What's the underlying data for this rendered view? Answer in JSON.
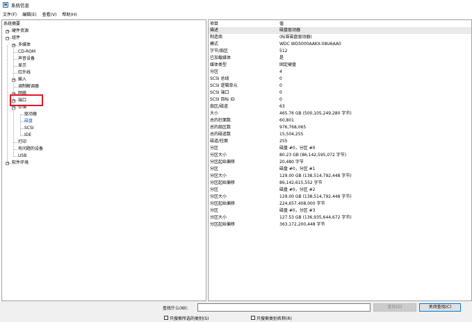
{
  "window": {
    "title": "系统信息",
    "icon": "system-info-icon"
  },
  "menu": [
    {
      "label": "文件(F)"
    },
    {
      "label": "编辑(E)"
    },
    {
      "label": "查看(V)"
    },
    {
      "label": "帮助(H)"
    }
  ],
  "tree": [
    {
      "label": "系统摘要",
      "level": 0,
      "expander": ""
    },
    {
      "label": "硬件资源",
      "level": 1,
      "expander": "+"
    },
    {
      "label": "组件",
      "level": 1,
      "expander": "−"
    },
    {
      "label": "多媒体",
      "level": 2,
      "expander": "+"
    },
    {
      "label": "CD-ROM",
      "level": 2,
      "expander": ""
    },
    {
      "label": "声音设备",
      "level": 2,
      "expander": ""
    },
    {
      "label": "显示",
      "level": 2,
      "expander": ""
    },
    {
      "label": "红外线",
      "level": 2,
      "expander": ""
    },
    {
      "label": "输入",
      "level": 2,
      "expander": "+"
    },
    {
      "label": "调制解调器",
      "level": 2,
      "expander": ""
    },
    {
      "label": "网络",
      "level": 2,
      "expander": "+"
    },
    {
      "label": "端口",
      "level": 2,
      "expander": "+"
    },
    {
      "label": "存储",
      "level": 2,
      "expander": "−"
    },
    {
      "label": "驱动器",
      "level": 3,
      "expander": ""
    },
    {
      "label": "磁盘",
      "level": 3,
      "expander": "",
      "selected": true
    },
    {
      "label": "SCSI",
      "level": 3,
      "expander": ""
    },
    {
      "label": "IDE",
      "level": 3,
      "expander": ""
    },
    {
      "label": "打印",
      "level": 2,
      "expander": ""
    },
    {
      "label": "有问题的设备",
      "level": 2,
      "expander": ""
    },
    {
      "label": "USB",
      "level": 2,
      "expander": ""
    },
    {
      "label": "软件环境",
      "level": 1,
      "expander": "+"
    }
  ],
  "details": {
    "header": {
      "key": "项目",
      "value": "值"
    },
    "rows": [
      {
        "key": "描述",
        "value": "磁盘驱动器"
      },
      {
        "key": "制造商",
        "value": "(标准磁盘驱动器)"
      },
      {
        "key": "模式",
        "value": "WDC WD5000AAKX-08U6AA0"
      },
      {
        "key": "字节/扇区",
        "value": "512"
      },
      {
        "key": "已加载媒体",
        "value": "是"
      },
      {
        "key": "媒体类型",
        "value": "固定硬盘"
      },
      {
        "key": "分区",
        "value": "4"
      },
      {
        "key": "SCSI 总线",
        "value": "0"
      },
      {
        "key": "SCSI 逻辑单元",
        "value": "0"
      },
      {
        "key": "SCSI 端口",
        "value": "0"
      },
      {
        "key": "SCSI 目标 ID",
        "value": "0"
      },
      {
        "key": "扇区/磁道",
        "value": "63"
      },
      {
        "key": "大小",
        "value": "465.76 GB (500,105,249,280 字节)"
      },
      {
        "key": "总的柱面数",
        "value": "60,801"
      },
      {
        "key": "总的扇区数",
        "value": "976,768,065"
      },
      {
        "key": "总的磁道数",
        "value": "15,504,255"
      },
      {
        "key": "磁道/柱面",
        "value": "255"
      },
      {
        "key": "分区",
        "value": "磁盘 #0，分区 #0"
      },
      {
        "key": "分区大小",
        "value": "80.23 GB (86,142,595,072 字节)"
      },
      {
        "key": "分区起始偏移",
        "value": "20,480 字节"
      },
      {
        "key": "分区",
        "value": "磁盘 #0，分区 #1"
      },
      {
        "key": "分区大小",
        "value": "129.00 GB (138,514,792,448 字节)"
      },
      {
        "key": "分区起始偏移",
        "value": "86,142,615,552 字节"
      },
      {
        "key": "分区",
        "value": "磁盘 #0，分区 #2"
      },
      {
        "key": "分区大小",
        "value": "129.00 GB (138,514,792,448 字节)"
      },
      {
        "key": "分区起始偏移",
        "value": "224,657,408,000 字节"
      },
      {
        "key": "分区",
        "value": "磁盘 #0，分区 #3"
      },
      {
        "key": "分区大小",
        "value": "127.53 GB (136,935,644,672 字节)"
      },
      {
        "key": "分区起始偏移",
        "value": "363,172,200,448 字节"
      }
    ]
  },
  "find": {
    "label": "查找什么(W):",
    "value": "",
    "find_button": "查找(D)",
    "close_button": "关闭查找(C)",
    "option_selected_only": "只搜索所选的类别(S)",
    "option_category_names": "只搜索类别名称(R)"
  }
}
